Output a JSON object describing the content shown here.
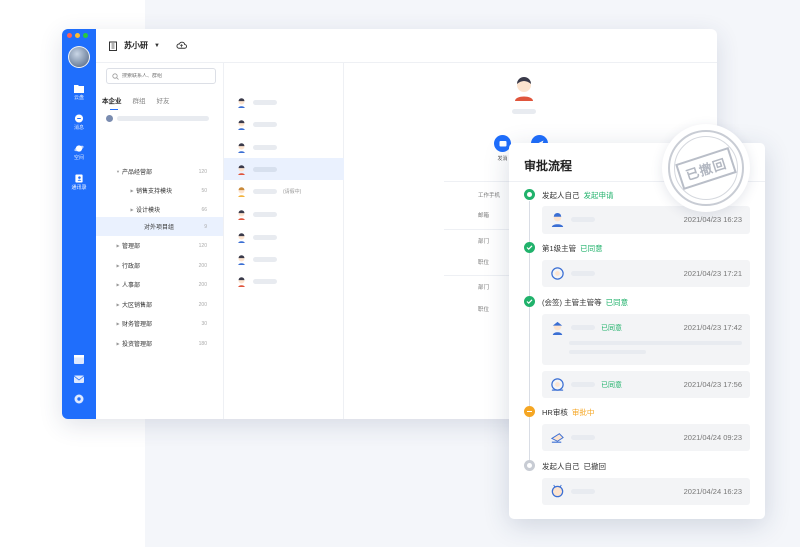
{
  "colors": {
    "accent": "#1f6efc",
    "success": "#20b26b",
    "pending": "#f5a623",
    "muted": "#c8ccd4"
  },
  "window": {
    "traffic_lights": [
      "#ff5f57",
      "#febc2e",
      "#28c840"
    ]
  },
  "rail": {
    "items": [
      {
        "icon": "folder-icon",
        "label": "云盘"
      },
      {
        "icon": "chat-bubble-icon",
        "label": "消息"
      },
      {
        "icon": "planet-icon",
        "label": "空间"
      },
      {
        "icon": "contacts-icon",
        "label": "通讯录"
      }
    ],
    "bottom_icons": [
      "calendar-icon",
      "mail-icon",
      "settings-icon"
    ]
  },
  "topbar": {
    "org_name": "苏小研",
    "caret": "▼"
  },
  "tree": {
    "search_placeholder": "搜索联系人、群组",
    "tabs": [
      "本企业",
      "群组",
      "好友"
    ],
    "rows": [
      {
        "label": "产品经营部",
        "count": "120",
        "arrow": "▼"
      },
      {
        "label": "销售支持模块",
        "count": "50",
        "arrow": "▶"
      },
      {
        "label": "设计模块",
        "count": "66",
        "arrow": "▶"
      },
      {
        "label": "对外项目组",
        "count": "9",
        "arrow": ""
      },
      {
        "label": "管理部",
        "count": "120",
        "arrow": "▶"
      },
      {
        "label": "行政部",
        "count": "200",
        "arrow": "▶"
      },
      {
        "label": "人事部",
        "count": "200",
        "arrow": "▶"
      },
      {
        "label": "大区销售部",
        "count": "200",
        "arrow": "▶"
      },
      {
        "label": "财务管理部",
        "count": "30",
        "arrow": "▶"
      },
      {
        "label": "投资管理部",
        "count": "180",
        "arrow": "▶"
      }
    ]
  },
  "people": {
    "leave_tag": "(请假中)"
  },
  "detail": {
    "actions": [
      "发消",
      ""
    ],
    "labels": [
      "工作手机",
      "邮箱",
      "部门",
      "职位",
      "部门",
      "职位"
    ]
  },
  "approval": {
    "title": "审批流程",
    "steps": [
      {
        "who": "发起人自己",
        "status": "发起申请",
        "status_type": "success",
        "entries": [
          {
            "status": "",
            "time": "2021/04/23 16:23"
          }
        ]
      },
      {
        "who": "第1级主管",
        "status": "已同意",
        "status_type": "success",
        "entries": [
          {
            "status": "",
            "time": "2021/04/23 17:21"
          }
        ]
      },
      {
        "who": "(会签) 主管主管等",
        "status": "已同意",
        "status_type": "success",
        "entries": [
          {
            "status": "已同意",
            "time": "2021/04/23 17:42"
          },
          {
            "status": "已同意",
            "time": "2021/04/23 17:56"
          }
        ]
      },
      {
        "who": "HR审核",
        "status": "审批中",
        "status_type": "pending",
        "entries": [
          {
            "status": "",
            "time": "2021/04/24 09:23"
          }
        ]
      },
      {
        "who": "发起人自己",
        "status": "已撤回",
        "status_type": "muted",
        "entries": [
          {
            "status": "",
            "time": "2021/04/24 16:23"
          }
        ]
      }
    ],
    "stamp": "已撤回"
  }
}
